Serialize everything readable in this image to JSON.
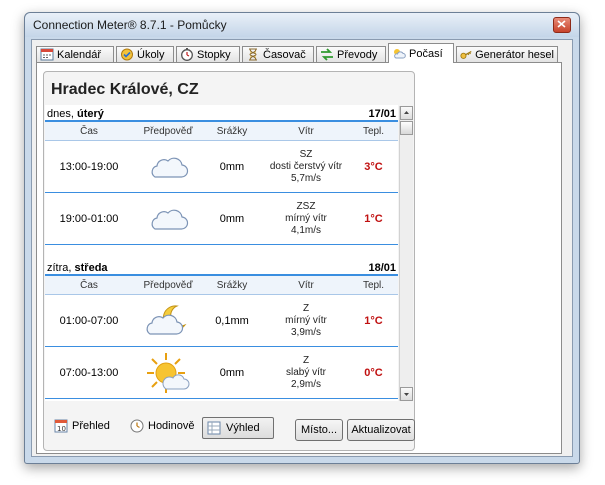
{
  "window": {
    "title": "Connection Meter® 8.7.1 - Pomůcky"
  },
  "tabs": [
    {
      "label": "Kalendář",
      "icon": "calendar-icon"
    },
    {
      "label": "Úkoly",
      "icon": "tasks-icon"
    },
    {
      "label": "Stopky",
      "icon": "stopwatch-icon"
    },
    {
      "label": "Časovač",
      "icon": "hourglass-icon"
    },
    {
      "label": "Převody",
      "icon": "conversion-icon"
    },
    {
      "label": "Počasí",
      "icon": "weather-icon",
      "active": true
    },
    {
      "label": "Generátor hesel",
      "icon": "key-icon"
    }
  ],
  "weather": {
    "location": "Hradec Králové, CZ",
    "columns": [
      "Čas",
      "Předpověď",
      "Srážky",
      "Vítr",
      "Tepl."
    ],
    "days": [
      {
        "prefix": "dnes, ",
        "weekday": "úterý",
        "date": "17/01",
        "rows": [
          {
            "time": "13:00-19:00",
            "icon": "cloud-icon",
            "precip": "0mm",
            "wind_dir": "SZ",
            "wind_desc": "dosti čerstvý vítr",
            "wind_speed": "5,7m/s",
            "temp": "3°C"
          },
          {
            "time": "19:00-01:00",
            "icon": "cloud-icon",
            "precip": "0mm",
            "wind_dir": "ZSZ",
            "wind_desc": "mírný vítr",
            "wind_speed": "4,1m/s",
            "temp": "1°C"
          }
        ]
      },
      {
        "prefix": "zítra, ",
        "weekday": "středa",
        "date": "18/01",
        "rows": [
          {
            "time": "01:00-07:00",
            "icon": "moon-cloud-icon",
            "precip": "0,1mm",
            "wind_dir": "Z",
            "wind_desc": "mírný vítr",
            "wind_speed": "3,9m/s",
            "temp": "1°C"
          },
          {
            "time": "07:00-13:00",
            "icon": "sun-cloud-icon",
            "precip": "0mm",
            "wind_dir": "Z",
            "wind_desc": "slabý vítr",
            "wind_speed": "2,9m/s",
            "temp": "0°C"
          }
        ]
      }
    ]
  },
  "bottom": {
    "overview_label": "Přehled",
    "hourly_label": "Hodinově",
    "outlook_label": "Výhled",
    "place_button": "Místo...",
    "refresh_button": "Aktualizovat"
  },
  "colors": {
    "accent_line": "#3a8ee0",
    "temp_text": "#c01010"
  }
}
